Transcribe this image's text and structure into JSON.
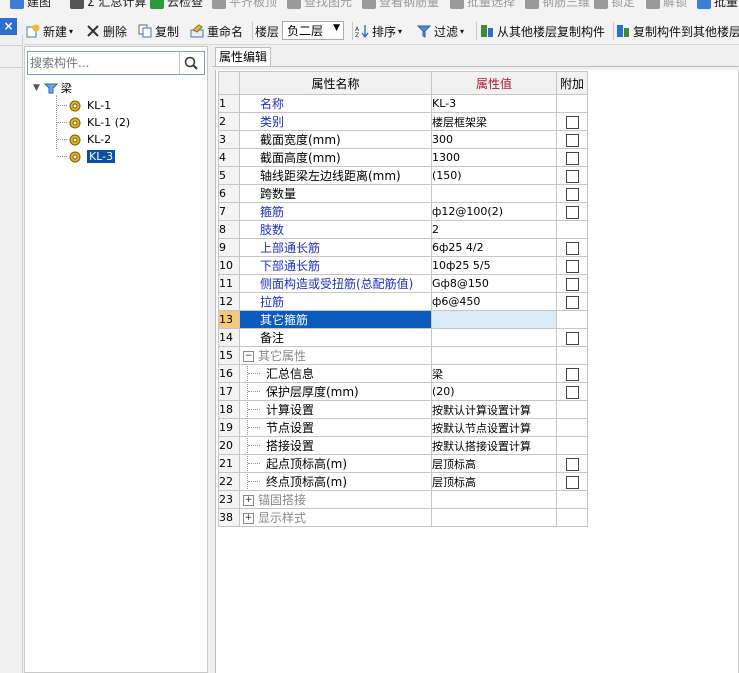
{
  "toolbar1": {
    "items": [
      {
        "label": "建图",
        "icon": "layer-icon",
        "enabled": true
      },
      {
        "label": "Σ 汇总计算",
        "icon": "sum-icon",
        "enabled": true
      },
      {
        "label": "云检查",
        "icon": "cloud-check-icon",
        "enabled": true
      },
      {
        "label": "平齐板顶",
        "icon": "align-top-icon",
        "enabled": false
      },
      {
        "label": "查找图元",
        "icon": "find-element-icon",
        "enabled": false
      },
      {
        "label": "查看钢筋量",
        "icon": "view-rebar-icon",
        "enabled": false
      },
      {
        "label": "批量选择",
        "icon": "batch-select-icon",
        "enabled": false
      },
      {
        "label": "钢筋三维",
        "icon": "rebar-3d-icon",
        "enabled": false
      },
      {
        "label": "锁定",
        "icon": "lock-icon",
        "enabled": false
      },
      {
        "label": "解锁",
        "icon": "unlock-icon",
        "enabled": false
      },
      {
        "label": "批量",
        "icon": "batch-icon",
        "enabled": true
      }
    ]
  },
  "toolbar2": {
    "new_label": "新建",
    "delete_label": "删除",
    "copy_label": "复制",
    "rename_label": "重命名",
    "floor_label": "楼层",
    "floor_value": "负二层",
    "sort_label": "排序",
    "filter_label": "过滤",
    "copy_from_floor_label": "从其他楼层复制构件",
    "copy_to_floor_label": "复制构件到其他楼层"
  },
  "close_glyph": "×",
  "search": {
    "placeholder": "搜索构件..."
  },
  "tree": {
    "root": "梁",
    "children": [
      "KL-1",
      "KL-1 (2)",
      "KL-2",
      "KL-3"
    ],
    "selected": "KL-3"
  },
  "tab": {
    "label": "属性编辑"
  },
  "grid": {
    "headers": {
      "name": "属性名称",
      "value": "属性值",
      "extra": "附加"
    },
    "rows": [
      {
        "num": "1",
        "name": "名称",
        "value": "KL-3",
        "style": "blue",
        "checkbox": false
      },
      {
        "num": "2",
        "name": "类别",
        "value": "楼层框架梁",
        "style": "blue",
        "checkbox": true
      },
      {
        "num": "3",
        "name": "截面宽度(mm)",
        "value": "300",
        "style": "normal",
        "checkbox": true
      },
      {
        "num": "4",
        "name": "截面高度(mm)",
        "value": "1300",
        "style": "normal",
        "checkbox": true
      },
      {
        "num": "5",
        "name": "轴线距梁左边线距离(mm)",
        "value": "(150)",
        "style": "normal",
        "checkbox": true
      },
      {
        "num": "6",
        "name": "跨数量",
        "value": "",
        "style": "normal",
        "checkbox": true
      },
      {
        "num": "7",
        "name": "箍筋",
        "value": "ф12@100(2)",
        "style": "blue",
        "checkbox": true
      },
      {
        "num": "8",
        "name": "肢数",
        "value": "2",
        "style": "blue",
        "checkbox": false
      },
      {
        "num": "9",
        "name": "上部通长筋",
        "value": "6ф25 4/2",
        "style": "blue",
        "checkbox": true
      },
      {
        "num": "10",
        "name": "下部通长筋",
        "value": "10ф25 5/5",
        "style": "blue",
        "checkbox": true
      },
      {
        "num": "11",
        "name": "侧面构造或受扭筋(总配筋值)",
        "value": "Gф8@150",
        "style": "blue",
        "checkbox": true
      },
      {
        "num": "12",
        "name": "拉筋",
        "value": "ф6@450",
        "style": "blue",
        "checkbox": true
      },
      {
        "num": "13",
        "name": "其它箍筋",
        "value": "",
        "style": "selected",
        "checkbox": false
      },
      {
        "num": "14",
        "name": "备注",
        "value": "",
        "style": "normal",
        "checkbox": true
      },
      {
        "num": "15",
        "name": "其它属性",
        "value": "",
        "style": "group-open",
        "checkbox": false
      },
      {
        "num": "16",
        "name": "汇总信息",
        "value": "梁",
        "style": "child",
        "checkbox": true
      },
      {
        "num": "17",
        "name": "保护层厚度(mm)",
        "value": "(20)",
        "style": "child",
        "checkbox": true
      },
      {
        "num": "18",
        "name": "计算设置",
        "value": "按默认计算设置计算",
        "style": "child",
        "checkbox": false
      },
      {
        "num": "19",
        "name": "节点设置",
        "value": "按默认节点设置计算",
        "style": "child",
        "checkbox": false
      },
      {
        "num": "20",
        "name": "搭接设置",
        "value": "按默认搭接设置计算",
        "style": "child",
        "checkbox": false
      },
      {
        "num": "21",
        "name": "起点顶标高(m)",
        "value": "层顶标高",
        "style": "child",
        "checkbox": true
      },
      {
        "num": "22",
        "name": "终点顶标高(m)",
        "value": "层顶标高",
        "style": "child",
        "checkbox": true
      },
      {
        "num": "23",
        "name": "锚固搭接",
        "value": "",
        "style": "group-closed",
        "checkbox": false
      },
      {
        "num": "38",
        "name": "显示样式",
        "value": "",
        "style": "group-closed",
        "checkbox": false
      }
    ]
  },
  "colors": {
    "selected_row": "#0a5bbd",
    "header_value_bg": "#f9c67a",
    "header_value_fg": "#b5162b",
    "blue_label": "#1c2fc9"
  }
}
